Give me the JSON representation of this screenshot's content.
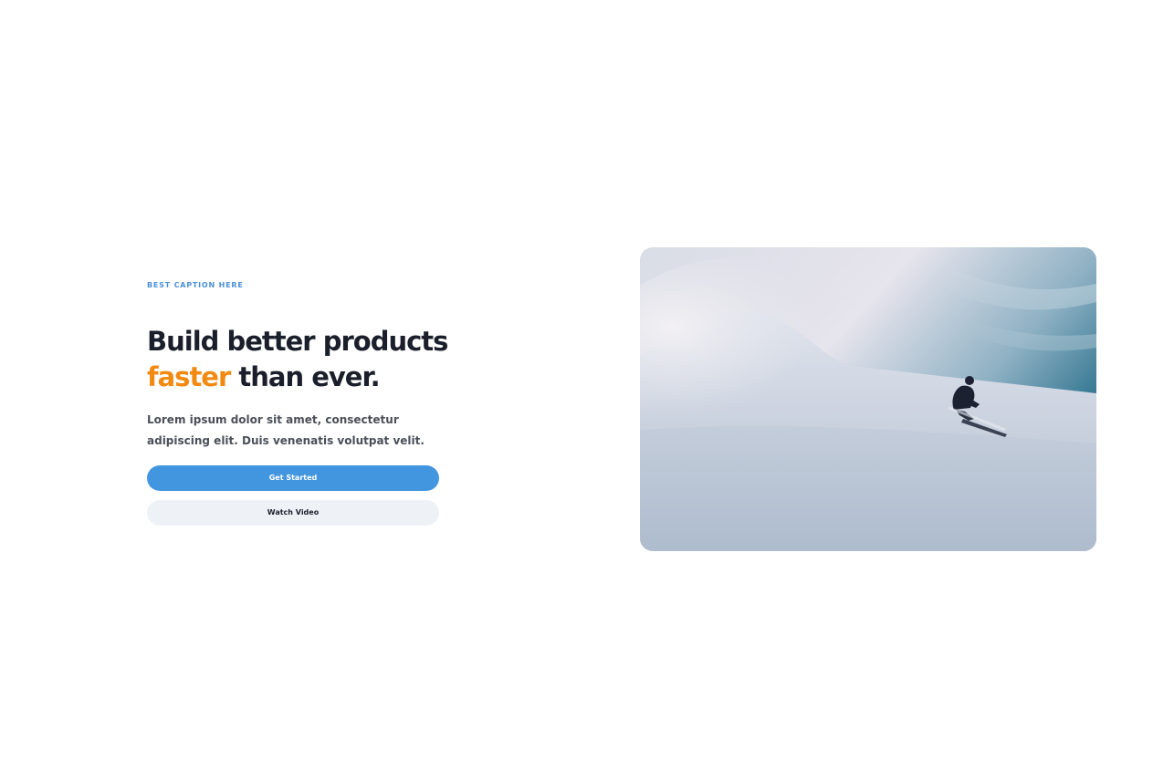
{
  "hero": {
    "caption": "BEST CAPTION HERE",
    "headline_line1": "Build better products",
    "headline_accent": "faster",
    "headline_rest": " than ever.",
    "description": "Lorem ipsum dolor sit amet, consectetur adipiscing elit. Duis venenatis volutpat velit.",
    "primary_button": "Get Started",
    "secondary_button": "Watch Video",
    "image_subject": "snowboarder-on-snowy-slope"
  },
  "colors": {
    "caption": "#4a90d9",
    "headline": "#1b1f2b",
    "accent": "#f28a12",
    "primary_button": "#4296e0",
    "secondary_button": "#eef2f6"
  }
}
